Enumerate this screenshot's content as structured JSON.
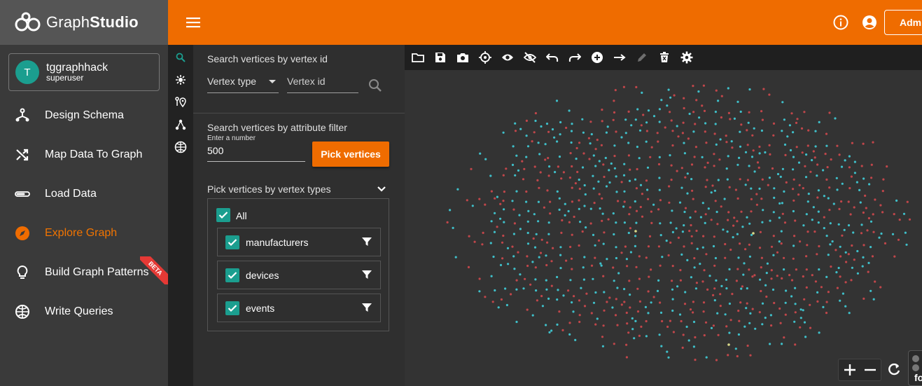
{
  "app": {
    "logo_text_a": "Graph",
    "logo_text_b": "Studio"
  },
  "user": {
    "initial": "T",
    "name": "tggraphhack",
    "role": "superuser"
  },
  "nav": {
    "items": [
      {
        "label": "Design Schema",
        "icon": "schema-icon"
      },
      {
        "label": "Map Data To Graph",
        "icon": "shuffle-icon"
      },
      {
        "label": "Load Data",
        "icon": "load-bar-icon"
      },
      {
        "label": "Explore Graph",
        "icon": "compass-icon",
        "active": true
      },
      {
        "label": "Build Graph Patterns",
        "icon": "lightbulb-icon"
      },
      {
        "label": "Write Queries",
        "icon": "globe-icon"
      }
    ],
    "beta_badge": "BETA"
  },
  "topbar": {
    "admin_label": "Admin"
  },
  "search": {
    "by_id_heading": "Search vertices by vertex id",
    "vertex_type_placeholder": "Vertex type",
    "vertex_id_placeholder": "Vertex id",
    "by_attr_heading": "Search vertices by attribute filter",
    "number_label": "Enter a number",
    "number_value": "500",
    "pick_button": "Pick vertices",
    "by_types_heading": "Pick vertices by vertex types",
    "all_label": "All",
    "types": [
      {
        "label": "manufacturers",
        "checked": true
      },
      {
        "label": "devices",
        "checked": true
      },
      {
        "label": "events",
        "checked": true
      }
    ]
  },
  "canvas": {
    "colors": {
      "red": "#c0464a",
      "teal": "#3fbfc9",
      "yellow": "#d9d98a",
      "accent": "#ef6c00",
      "check": "#1b9e8f"
    },
    "mini_panel_text": "fo"
  }
}
